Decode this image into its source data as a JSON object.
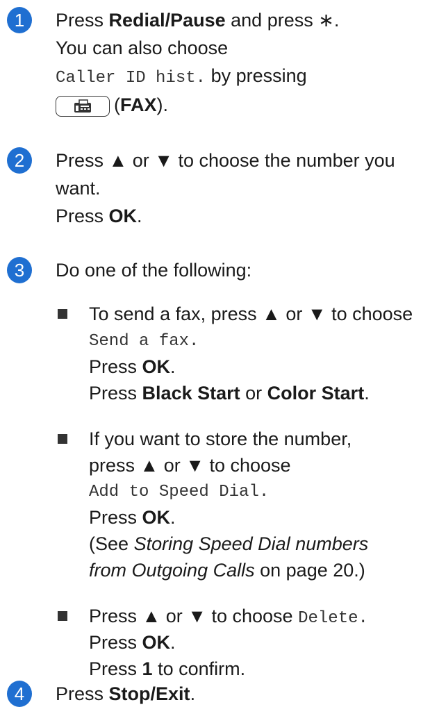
{
  "step1": {
    "number": "1",
    "press": "Press",
    "redial": "Redial/Pause",
    "and_press": "and press",
    "star": "∗.",
    "also": "You can also choose",
    "caller_id": "Caller ID hist.",
    "by_pressing": "by pressing",
    "fax_open": "(",
    "fax": "FAX",
    "fax_close": ")."
  },
  "step2": {
    "number": "2",
    "line1": "Press ▲ or ▼ to choose the number you",
    "line2": "want.",
    "press": "Press",
    "ok": "OK",
    "period": "."
  },
  "step3": {
    "number": "3",
    "intro": "Do one of the following:",
    "b1_line1": "To send a fax, press ▲ or ▼ to choose",
    "b1_option": "Send a fax.",
    "press": "Press",
    "ok": "OK",
    "period": ".",
    "black_start": "Black Start",
    "or": "or",
    "color_start": "Color Start",
    "b2_line1": "If you want to store the number,",
    "b2_line2": "press ▲ or ▼ to choose",
    "b2_option": "Add to Speed Dial.",
    "see_open": "(See",
    "see_ref1": "Storing Speed Dial numbers",
    "see_ref2": "from Outgoing Calls",
    "see_tail": "on page 20.)",
    "b3_line1": "Press ▲ or ▼ to choose",
    "b3_option": "Delete.",
    "press_one": "1",
    "to_confirm": "to confirm."
  },
  "step4": {
    "number": "4",
    "press": "Press",
    "stop": "Stop/Exit",
    "period": "."
  },
  "colors": {
    "accent": "#1f6fd1",
    "text": "#1a1a1a"
  },
  "icons": {
    "fax_button": "fax-icon",
    "bullet": "square-bullet"
  }
}
